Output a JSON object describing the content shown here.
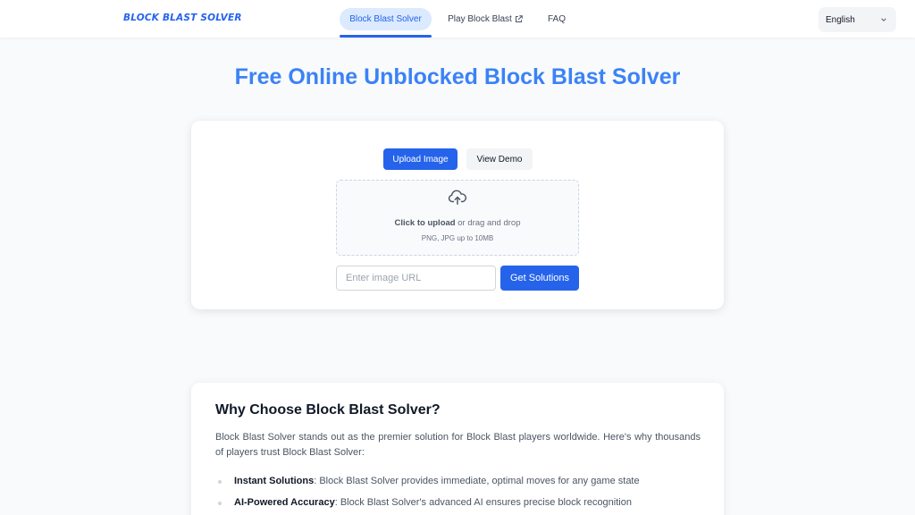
{
  "header": {
    "logo": "BLOCK BLAST SOLVER",
    "nav": [
      {
        "label": "Block Blast Solver",
        "active": true
      },
      {
        "label": "Play Block Blast",
        "icon": "external-link-icon"
      },
      {
        "label": "FAQ"
      }
    ],
    "language": {
      "selected": "English",
      "icon": "chevron-down-icon"
    }
  },
  "hero": {
    "title": "Free Online Unblocked Block Blast Solver"
  },
  "uploader": {
    "upload_button": "Upload Image",
    "demo_button": "View Demo",
    "cloud_icon": "cloud-upload-icon",
    "drop_strong": "Click to upload",
    "drop_rest": " or drag and drop",
    "drop_hint": "PNG, JPG up to 10MB",
    "url_placeholder": "Enter image URL",
    "url_value": "",
    "solve_button": "Get Solutions"
  },
  "why": {
    "title": "Why Choose Block Blast Solver?",
    "paragraph": "Block Blast Solver stands out as the premier solution for Block Blast players worldwide. Here's why thousands of players trust Block Blast Solver:",
    "items": [
      {
        "strong": "Instant Solutions",
        "text": ": Block Blast Solver provides immediate, optimal moves for any game state"
      },
      {
        "strong": "AI-Powered Accuracy",
        "text": ": Block Blast Solver's advanced AI ensures precise block recognition"
      }
    ]
  },
  "colors": {
    "accent": "#2563eb",
    "title": "#3b82f6",
    "active_nav_bg": "#dbeafe"
  }
}
